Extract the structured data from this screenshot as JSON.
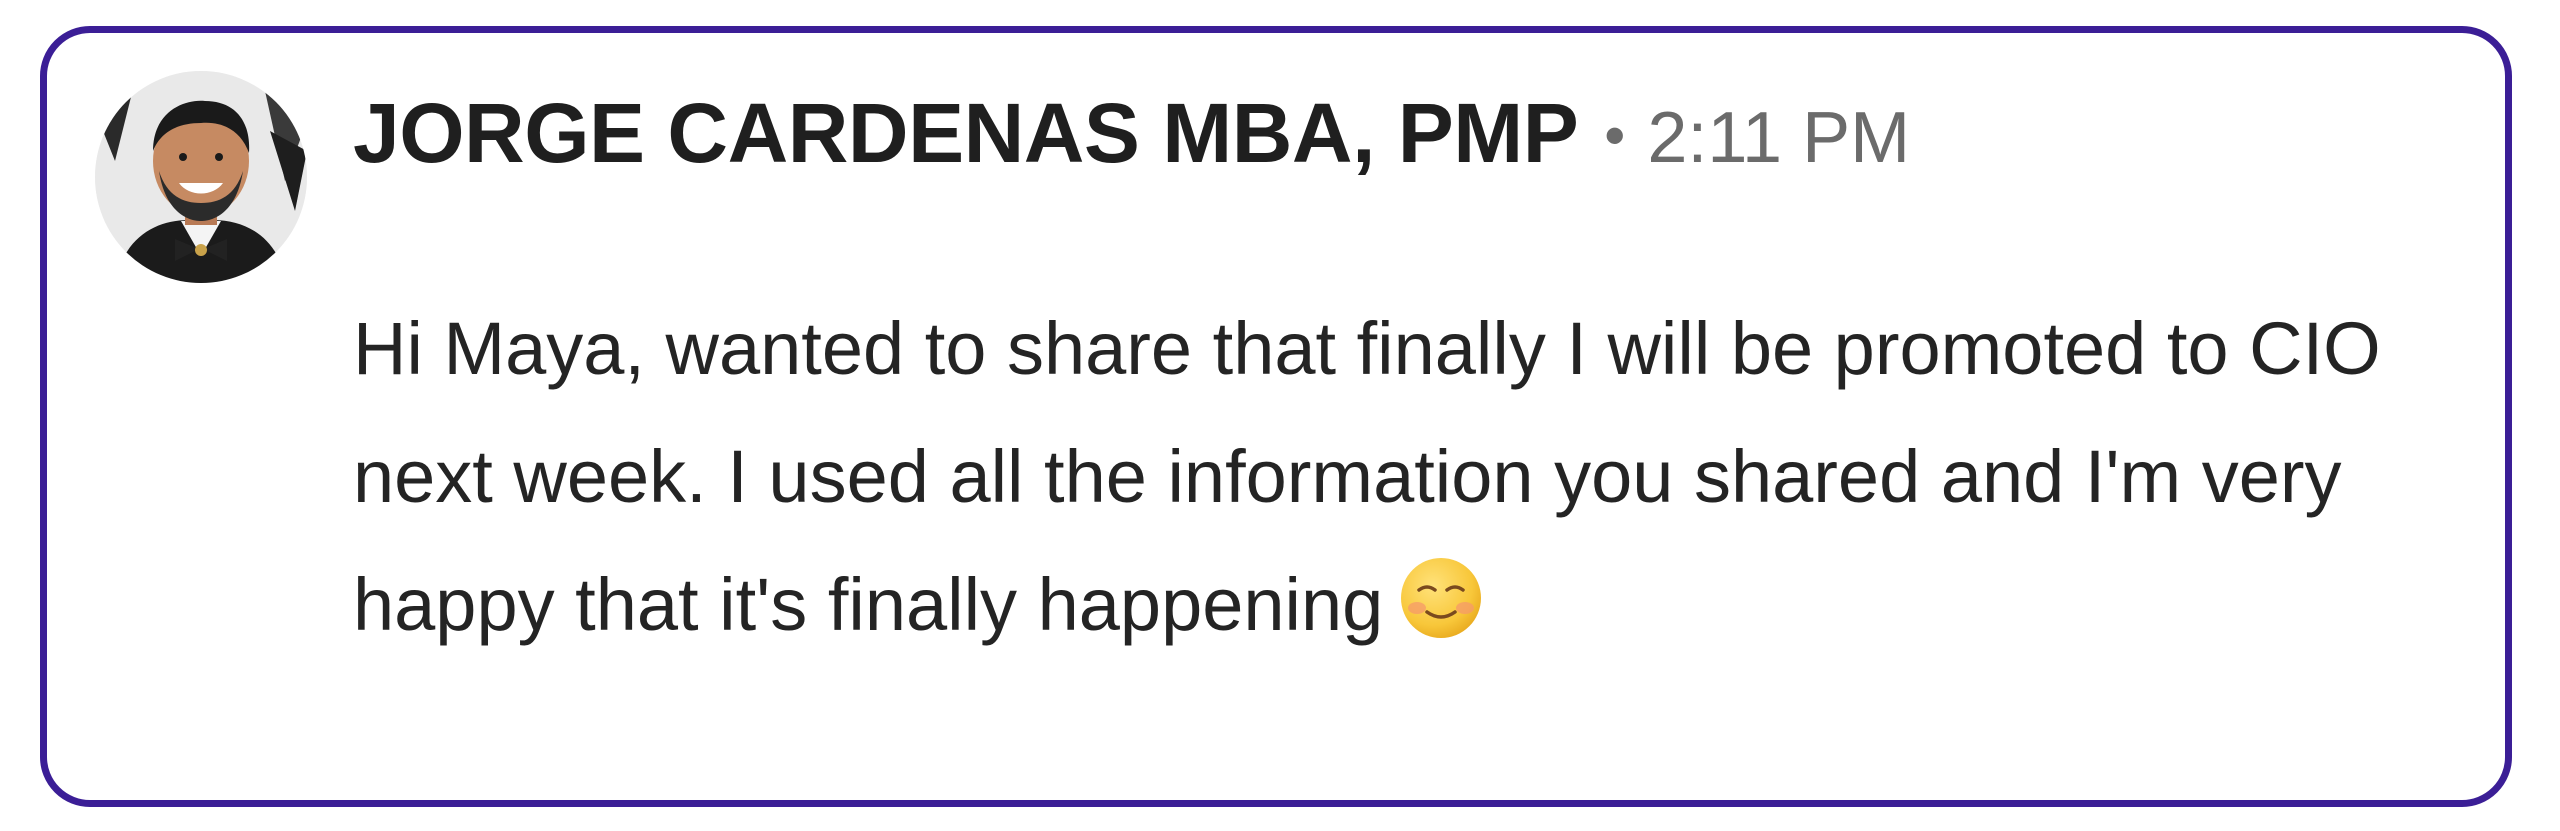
{
  "message": {
    "sender_name": "JORGE CARDENAS MBA, PMP",
    "separator": "•",
    "timestamp": "2:11 PM",
    "text": "Hi Maya, wanted to share that finally I will be promoted to CIO next week. I used all the information you shared and I'm very happy that it's finally happening",
    "emoji_icon": "smiling-blushing-face-icon"
  },
  "colors": {
    "border": "#3b1e96",
    "name_text": "#1f1f1f",
    "meta_text": "#6b6b6b",
    "body_text": "#242424"
  }
}
